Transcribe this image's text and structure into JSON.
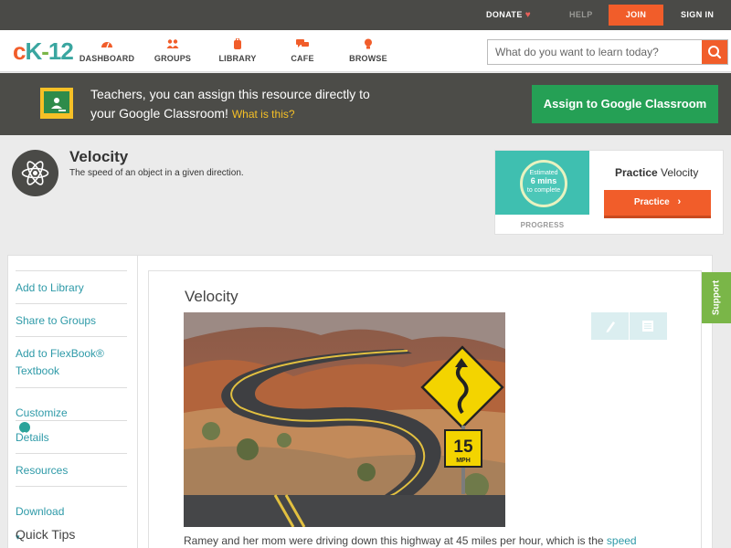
{
  "topbar": {
    "donate": "DONATE",
    "help": "HELP",
    "join": "JOIN",
    "signin": "SIGN IN"
  },
  "logo": {
    "c": "c",
    "k": "K",
    "dash": "-",
    "num": "12"
  },
  "nav": {
    "dashboard": "DASHBOARD",
    "groups": "GROUPS",
    "library": "LIBRARY",
    "cafe": "CAFE",
    "browse": "BROWSE"
  },
  "search": {
    "placeholder": "What do you want to learn today?"
  },
  "banner": {
    "line1": "Teachers, you can assign this resource directly to",
    "line2": "your Google Classroom!",
    "link": "What is this?",
    "assign_button": "Assign to Google Classroom"
  },
  "concept": {
    "title": "Velocity",
    "subtitle": "The speed of an object in a given direction."
  },
  "practice_card": {
    "estimated": "Estimated",
    "mins": "6 mins",
    "to_complete": "to complete",
    "progress_label": "PROGRESS",
    "heading_bold": "Practice",
    "heading_rest": " Velocity",
    "button": "Practice"
  },
  "sidebar": {
    "items": [
      "Add to Library",
      "Share to Groups",
      "Add to FlexBook® Textbook",
      "Customize",
      "Details",
      "Resources",
      "Download"
    ],
    "customize_badge": "?",
    "download_caret": "▾",
    "quick_tips": "Quick Tips"
  },
  "article": {
    "title": "Velocity",
    "sign_top": "15",
    "sign_bottom": "MPH",
    "text_before": "Ramey and her mom were driving down this highway at 45 miles per hour, which is the ",
    "text_link": "speed"
  },
  "support": "Support",
  "colors": {
    "accent_orange": "#f15d2a",
    "teal": "#2e9aa8",
    "google_green": "#25a055",
    "support_green": "#7ab648"
  },
  "icons": {
    "dashboard": "speedometer-icon",
    "groups": "people-icon",
    "library": "backpack-icon",
    "cafe": "chat-bubbles-icon",
    "browse": "lightbulb-icon",
    "search": "magnifier-icon",
    "concept": "atom-icon",
    "edit": "pencil-icon",
    "notes": "notepad-icon"
  }
}
